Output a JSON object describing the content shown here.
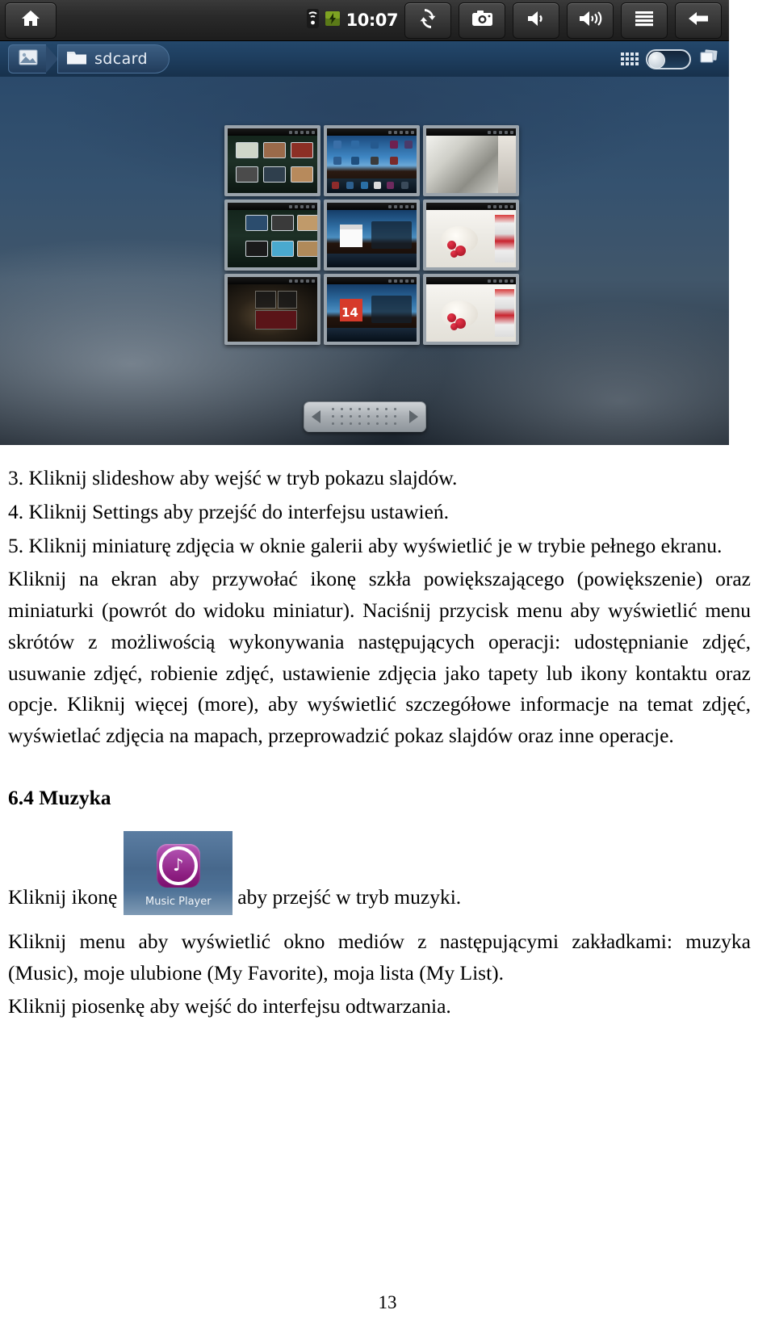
{
  "screenshot": {
    "statusbar": {
      "home_label": "home-icon",
      "time": "10:07",
      "wifi_label": "wifi-icon",
      "battery_label": "battery-charging-icon",
      "buttons": [
        {
          "name": "refresh",
          "glyph": "⟳"
        },
        {
          "name": "screenshot-camera",
          "glyph": "■"
        },
        {
          "name": "volume-down",
          "glyph": "◄"
        },
        {
          "name": "volume-up",
          "glyph": "◄"
        },
        {
          "name": "menu",
          "glyph": "☰"
        },
        {
          "name": "back",
          "glyph": "←"
        }
      ]
    },
    "breadcrumb": {
      "gallery_icon": "picture-icon",
      "folder_icon": "folder-icon",
      "folder_name": "sdcard",
      "grid_view_icon": "grid-view-icon",
      "toggle_state": "off",
      "stack_icon": "stacked-cards-icon"
    },
    "pager": {
      "prev_label": "previous-page",
      "next_label": "next-page"
    },
    "thumbnails": [
      {
        "id": "thumb-1",
        "kind": "homescreen-dark"
      },
      {
        "id": "thumb-2",
        "kind": "homescreen-sky"
      },
      {
        "id": "thumb-3",
        "kind": "flowers-photo"
      },
      {
        "id": "thumb-4",
        "kind": "homescreen-dark-2"
      },
      {
        "id": "thumb-5",
        "kind": "homescreen-calendar-weather"
      },
      {
        "id": "thumb-6",
        "kind": "food-webpage"
      },
      {
        "id": "thumb-7",
        "kind": "dark-widgets"
      },
      {
        "id": "thumb-8",
        "kind": "homescreen-date-14"
      },
      {
        "id": "thumb-9",
        "kind": "food-webpage-2"
      }
    ]
  },
  "document": {
    "item3": "3. Kliknij slideshow aby wejść w tryb pokazu slajdów.",
    "item4": "4. Kliknij Settings aby przejść do interfejsu ustawień.",
    "item5": "5. Kliknij miniaturę zdjęcia w oknie galerii aby wyświetlić je w trybie pełnego ekranu.",
    "para_main": "Kliknij na ekran aby przywołać ikonę szkła powiększającego (powiększenie) oraz miniaturki (powrót do widoku miniatur). Naciśnij przycisk menu aby wyświetlić menu skrótów z możliwością wykonywania następujących operacji: udostępnianie zdjęć, usuwanie zdjęć, robienie zdjęć, ustawienie zdjęcia jako tapety lub ikony kontaktu oraz opcje. Kliknij więcej (more), aby wyświetlić szczegółowe informacje na temat zdjęć, wyświetlać zdjęcia na mapach, przeprowadzić pokaz slajdów oraz inne operacje.",
    "heading_music": "6.4 Muzyka",
    "music_lead": "Kliknij ikonę",
    "music_tile_label": "Music Player",
    "music_tail": "aby przejść w tryb muzyki.",
    "para_menu": "Kliknij menu aby wyświetlić okno mediów z następującymi zakładkami: muzyka (Music), moje ulubione (My Favorite), moja lista (My List).",
    "para_song": "Kliknij piosenkę aby wejść do interfejsu odtwarzania.",
    "page_number": "13"
  },
  "colors": {
    "toolbar_dark": "#2a2a2a",
    "breadcrumb_blue": "#1d3c5c",
    "gallery_blue": "#35526f",
    "music_icon_purple": "#a23d9e"
  }
}
